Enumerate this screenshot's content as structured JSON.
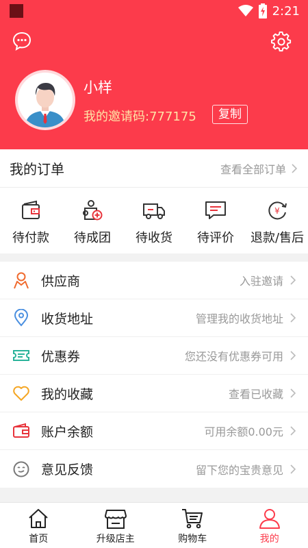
{
  "status_bar": {
    "time": "2:21"
  },
  "header": {
    "username": "小样",
    "invite_text": "我的邀请码:777175",
    "copy_label": "复制"
  },
  "orders": {
    "title": "我的订单",
    "view_all": "查看全部订单",
    "tabs": [
      {
        "label": "待付款",
        "icon": "wallet-icon"
      },
      {
        "label": "待成团",
        "icon": "group-add-icon"
      },
      {
        "label": "待收货",
        "icon": "delivery-truck-icon"
      },
      {
        "label": "待评价",
        "icon": "comment-icon"
      },
      {
        "label": "退款/售后",
        "icon": "refund-icon"
      }
    ]
  },
  "menu": [
    {
      "label": "供应商",
      "sub": "入驻邀请",
      "icon": "person-icon"
    },
    {
      "label": "收货地址",
      "sub": "管理我的收货地址",
      "icon": "location-pin-icon"
    },
    {
      "label": "优惠券",
      "sub": "您还没有优惠券可用",
      "icon": "ticket-icon"
    },
    {
      "label": "我的收藏",
      "sub": "查看已收藏",
      "icon": "heart-icon"
    },
    {
      "label": "账户余额",
      "sub": "可用余额0.00元",
      "icon": "wallet-icon"
    },
    {
      "label": "意见反馈",
      "sub": "留下您的宝贵意见",
      "icon": "feedback-face-icon"
    }
  ],
  "tabbar": [
    {
      "label": "首页",
      "icon": "home-icon"
    },
    {
      "label": "升级店主",
      "icon": "store-icon"
    },
    {
      "label": "购物车",
      "icon": "cart-icon"
    },
    {
      "label": "我的",
      "icon": "user-icon",
      "active": true
    }
  ],
  "colors": {
    "brand_red": "#fc3b4b",
    "invite_yellow": "#ffe3a6",
    "orange_icon": "#f06a2e",
    "blue_icon": "#4a8fe0",
    "teal_icon": "#2ab39a",
    "amber_icon": "#f5a623"
  }
}
